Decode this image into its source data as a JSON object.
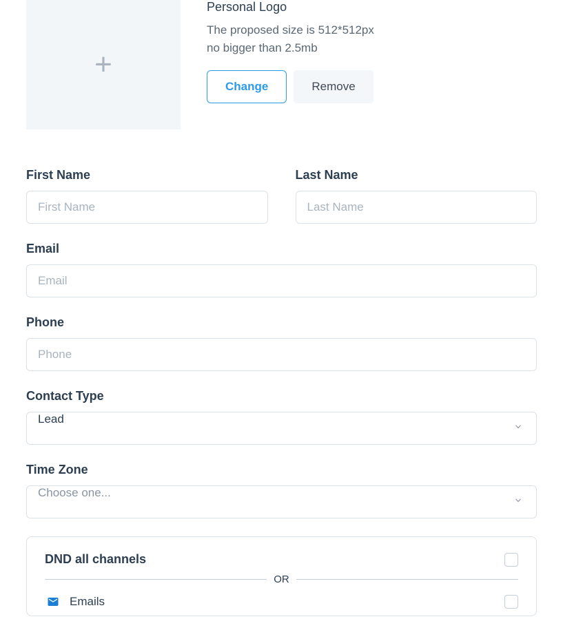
{
  "logo": {
    "title": "Personal Logo",
    "desc_line1": "The proposed size is 512*512px",
    "desc_line2": "no bigger than 2.5mb",
    "change_label": "Change",
    "remove_label": "Remove"
  },
  "fields": {
    "first_name": {
      "label": "First Name",
      "placeholder": "First Name",
      "value": ""
    },
    "last_name": {
      "label": "Last Name",
      "placeholder": "Last Name",
      "value": ""
    },
    "email": {
      "label": "Email",
      "placeholder": "Email",
      "value": ""
    },
    "phone": {
      "label": "Phone",
      "placeholder": "Phone",
      "value": ""
    },
    "contact_type": {
      "label": "Contact Type",
      "value": "Lead"
    },
    "time_zone": {
      "label": "Time Zone",
      "value": "Choose one..."
    }
  },
  "dnd": {
    "all_label": "DND all channels",
    "or_label": "OR",
    "emails_label": "Emails"
  }
}
